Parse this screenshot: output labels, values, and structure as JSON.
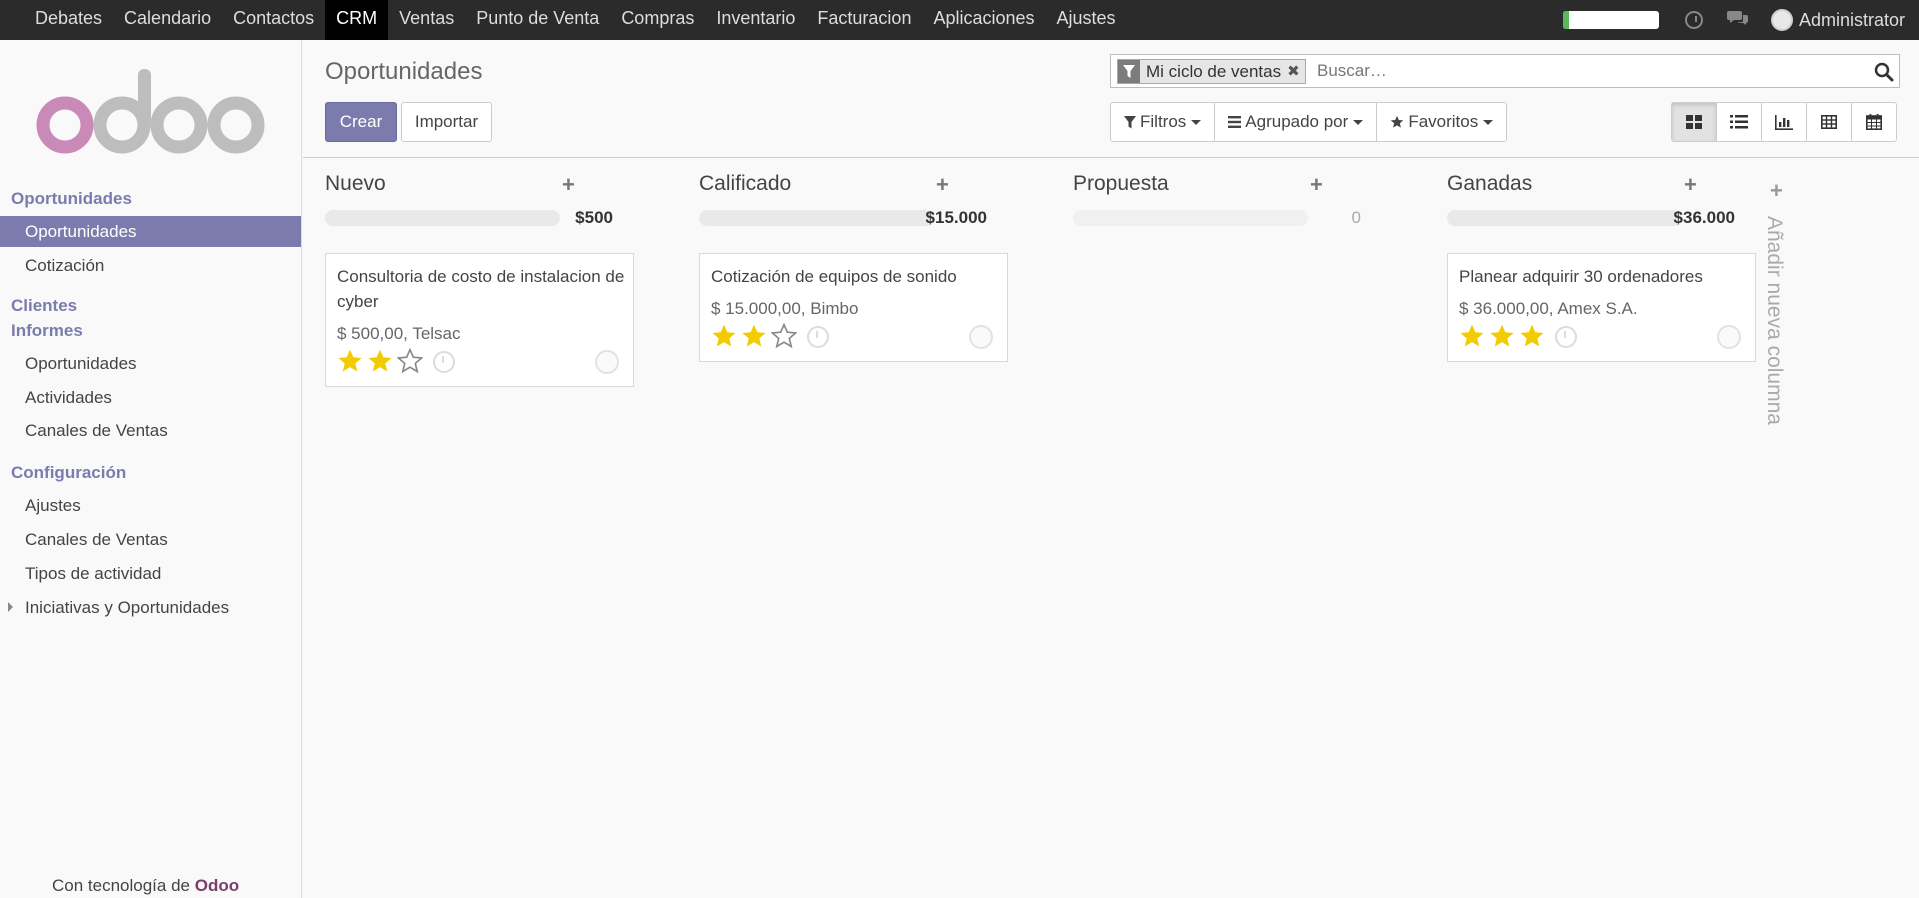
{
  "topbar": {
    "menu": [
      "Debates",
      "Calendario",
      "Contactos",
      "CRM",
      "Ventas",
      "Punto de Venta",
      "Compras",
      "Inventario",
      "Facturacion",
      "Aplicaciones",
      "Ajustes"
    ],
    "active_index": 3,
    "user": "Administrator",
    "progress_fraction": 0.06,
    "icons": [
      "clock-icon",
      "chat-icon",
      "user-avatar"
    ]
  },
  "sidebar": {
    "logo_text": "odoo",
    "sections": {
      "oportunidades": "Oportunidades",
      "clientes": "Clientes",
      "informes": "Informes",
      "configuracion": "Configuración"
    },
    "items": {
      "oportunidades": "Oportunidades",
      "cotizacion": "Cotización",
      "inf_oportunidades": "Oportunidades",
      "actividades": "Actividades",
      "canales": "Canales de Ventas",
      "ajustes": "Ajustes",
      "cfg_canales": "Canales de Ventas",
      "tipos": "Tipos de actividad",
      "iniciativas": "Iniciativas y Oportunidades"
    },
    "powered_prefix": "Con tecnología de",
    "powered_brand": "Odoo"
  },
  "control": {
    "title": "Oportunidades",
    "create_label": "Crear",
    "import_label": "Importar",
    "facet_label": "Mi ciclo de ventas",
    "facet_remove": "✖",
    "search_placeholder": "Buscar…",
    "filters_label": "Filtros",
    "groupby_label": "Agrupado por",
    "favorites_label": "Favoritos",
    "views": [
      "kanban",
      "list",
      "graph",
      "pivot",
      "calendar"
    ],
    "active_view": "kanban"
  },
  "kanban": {
    "columns": [
      {
        "title": "Nuevo",
        "total": "$500",
        "cards": [
          {
            "title": "Consultoria de costo de instalacion de cyber",
            "sub": "$ 500,00, Telsac",
            "stars": 2
          }
        ]
      },
      {
        "title": "Calificado",
        "total": "$15.000",
        "cards": [
          {
            "title": "Cotización de equipos de sonido",
            "sub": "$ 15.000,00, Bimbo",
            "stars": 2
          }
        ]
      },
      {
        "title": "Propuesta",
        "total": "0",
        "cards": []
      },
      {
        "title": "Ganadas",
        "total": "$36.000",
        "cards": [
          {
            "title": "Planear adquirir 30 ordenadores",
            "sub": "$ 36.000,00, Amex S.A.",
            "stars": 3
          }
        ]
      }
    ],
    "add_plus": "+",
    "add_column_label": "Añadir nueva columna"
  },
  "colors": {
    "accent": "#7c7bad",
    "star_on": "#f3cc00",
    "topbar": "#2b2b2b"
  }
}
